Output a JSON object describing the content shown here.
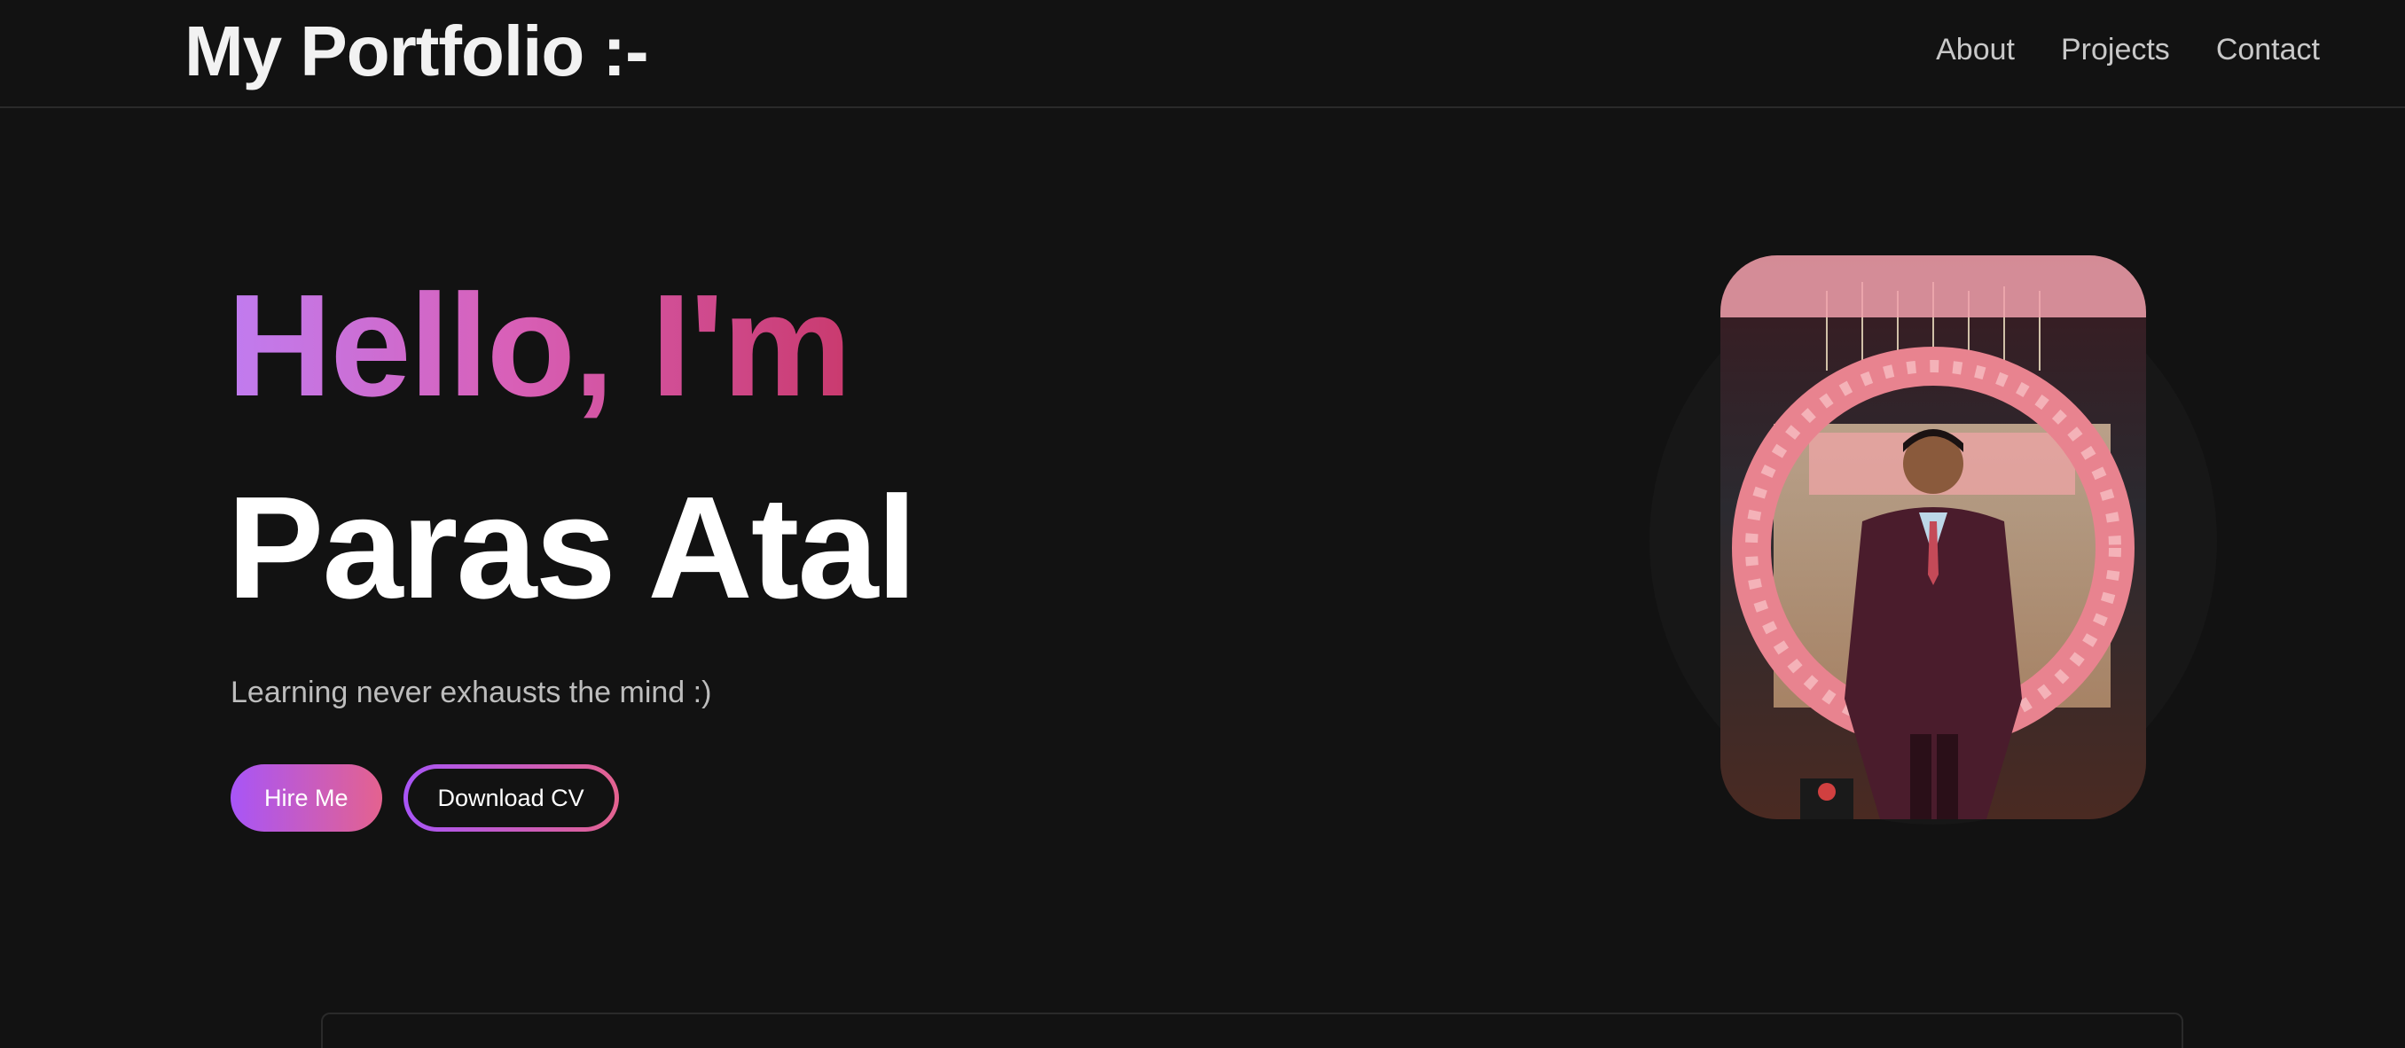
{
  "header": {
    "brand": "My Portfolio :-",
    "nav": [
      {
        "label": "About"
      },
      {
        "label": "Projects"
      },
      {
        "label": "Contact"
      }
    ]
  },
  "hero": {
    "greeting": "Hello, I'm",
    "name": "Paras Atal",
    "tagline": "Learning never exhausts the mind :)",
    "hire_label": "Hire Me",
    "cv_label": "Download CV"
  },
  "colors": {
    "background": "#121212",
    "accent_start": "#a855f7",
    "accent_end": "#e4628f"
  },
  "icons": {
    "portrait": "profile-photo"
  }
}
